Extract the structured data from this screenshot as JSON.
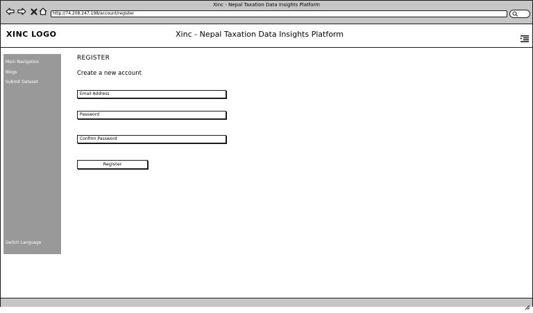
{
  "browser": {
    "window_title": "Xinc - Nepal Taxation Data Insights Platform",
    "url": "http://74.208.247.198/account/register",
    "icons": [
      "back-arrow-icon",
      "forward-arrow-icon",
      "stop-icon",
      "home-icon",
      "search-icon"
    ]
  },
  "header": {
    "logo": "XINC LOGO",
    "title": "Xinc - Nepal Taxation Data Insights Platform",
    "menu_icon": "menu-icon"
  },
  "sidebar": {
    "items": [
      {
        "label": "Main Navigation"
      },
      {
        "label": "Blogs"
      },
      {
        "label": "Submit Dataset"
      }
    ],
    "footer_item": {
      "label": "Switch Language"
    }
  },
  "main": {
    "heading": "REGISTER",
    "subheading": "Create a new account",
    "fields": [
      {
        "label": "Email Address"
      },
      {
        "label": "Password"
      },
      {
        "label": "Confirm Password"
      }
    ],
    "register_button": "Register"
  },
  "colors": {
    "chrome": "#c6c6c6",
    "sidebar": "#999999",
    "border": "#1a1a1a"
  }
}
